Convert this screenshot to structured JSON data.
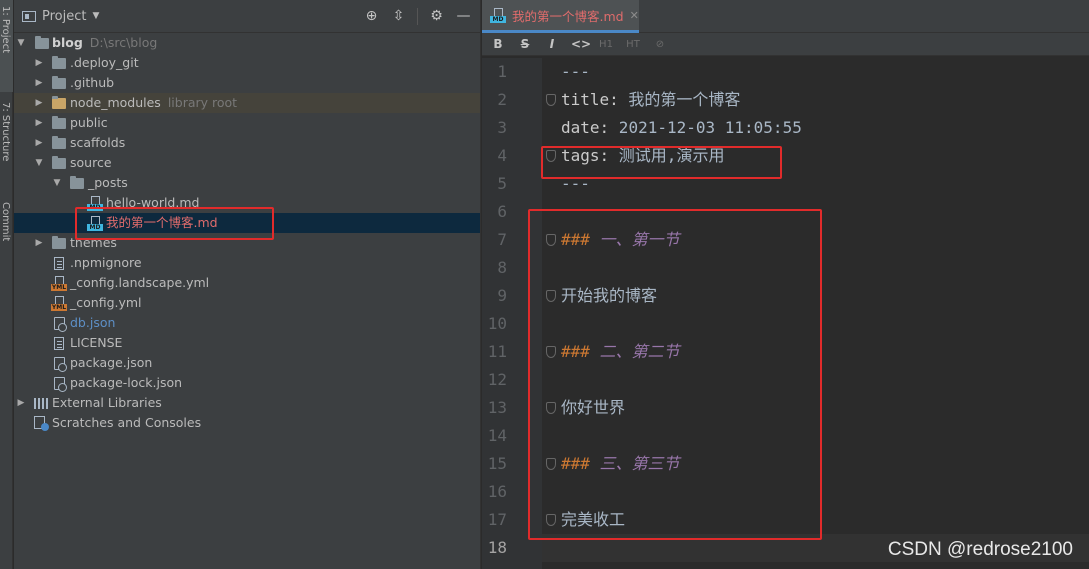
{
  "stripe": {
    "project_tab": "1: Project",
    "structure_tab": "7: Structure",
    "commit_tab": "Commit"
  },
  "project_panel": {
    "title": "Project",
    "tree": [
      {
        "label": "blog",
        "hint": "D:\\src\\blog",
        "type": "folder",
        "expanded": true
      },
      {
        "label": ".deploy_git",
        "type": "folder"
      },
      {
        "label": ".github",
        "type": "folder"
      },
      {
        "label": "node_modules",
        "hint": "library root",
        "type": "folder"
      },
      {
        "label": "public",
        "type": "folder"
      },
      {
        "label": "scaffolds",
        "type": "folder"
      },
      {
        "label": "source",
        "type": "folder",
        "expanded": true
      },
      {
        "label": "_posts",
        "type": "folder",
        "expanded": true
      },
      {
        "label": "hello-world.md",
        "type": "md"
      },
      {
        "label": "我的第一个博客.md",
        "type": "md",
        "selected": true
      },
      {
        "label": "themes",
        "type": "folder"
      },
      {
        "label": ".npmignore",
        "type": "file"
      },
      {
        "label": "_config.landscape.yml",
        "type": "yml"
      },
      {
        "label": "_config.yml",
        "type": "yml"
      },
      {
        "label": "db.json",
        "type": "json"
      },
      {
        "label": "LICENSE",
        "type": "file"
      },
      {
        "label": "package.json",
        "type": "json"
      },
      {
        "label": "package-lock.json",
        "type": "json"
      },
      {
        "label": "External Libraries",
        "type": "libraries"
      },
      {
        "label": "Scratches and Consoles",
        "type": "scratches"
      }
    ]
  },
  "editor": {
    "tab_title": "我的第一个博客.md",
    "toolbar": [
      "B",
      "S",
      "I",
      "<>",
      "H1",
      "HT",
      "link"
    ],
    "line_numbers": [
      "1",
      "2",
      "3",
      "4",
      "5",
      "6",
      "7",
      "8",
      "9",
      "10",
      "11",
      "12",
      "13",
      "14",
      "15",
      "16",
      "17",
      "18"
    ],
    "current_line": 18,
    "lines": {
      "l1": "---",
      "l2_key": "title:",
      "l2_val": " 我的第一个博客",
      "l3_key": "date:",
      "l3_val": " 2021-12-03 11:05:55",
      "l4_key": "tags:",
      "l4_val": " 测试用,演示用",
      "l5": "---",
      "l7_mark": "###",
      "l7_text": " 一、第一节",
      "l9": "开始我的博客",
      "l11_mark": "###",
      "l11_text": " 二、第二节",
      "l13": "你好世界",
      "l15_mark": "###",
      "l15_text": " 三、第三节",
      "l17": "完美收工"
    }
  },
  "watermark": "CSDN @redrose2100",
  "colors": {
    "annotation": "#e12b2b",
    "selected_file": "#e06c6c",
    "accent": "#4a88c7"
  }
}
